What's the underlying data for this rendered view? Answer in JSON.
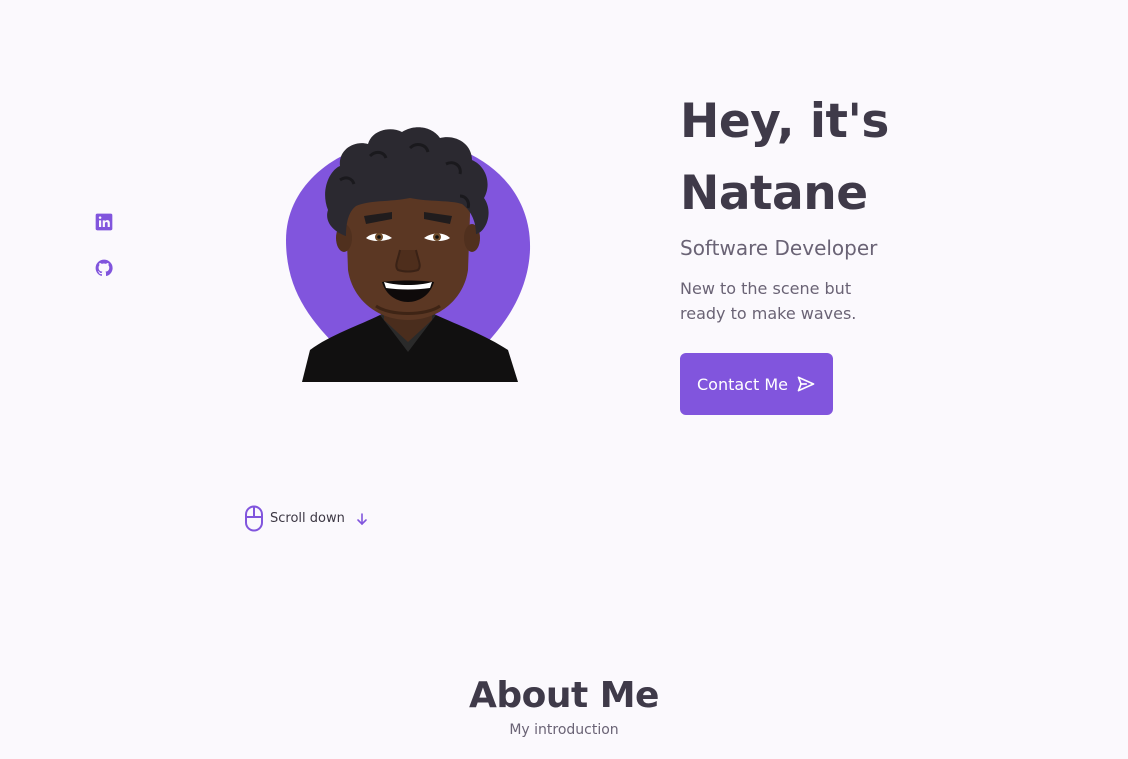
{
  "social": {
    "linkedin_icon": "linkedin-icon",
    "github_icon": "github-icon"
  },
  "hero": {
    "title_line1": "Hey, it's",
    "title_line2": "Natane",
    "subtitle": "Software Developer",
    "description": "New to the scene but ready to make waves.",
    "contact_label": "Contact Me",
    "contact_icon": "send-icon"
  },
  "scroll": {
    "label": "Scroll down",
    "mouse_icon": "mouse-icon",
    "arrow_icon": "arrow-down-icon"
  },
  "about": {
    "title": "About Me",
    "subtitle": "My introduction"
  },
  "colors": {
    "accent": "#8155dd",
    "background": "#fbf9fd",
    "heading": "#3f3a49",
    "text": "#6a6375"
  }
}
